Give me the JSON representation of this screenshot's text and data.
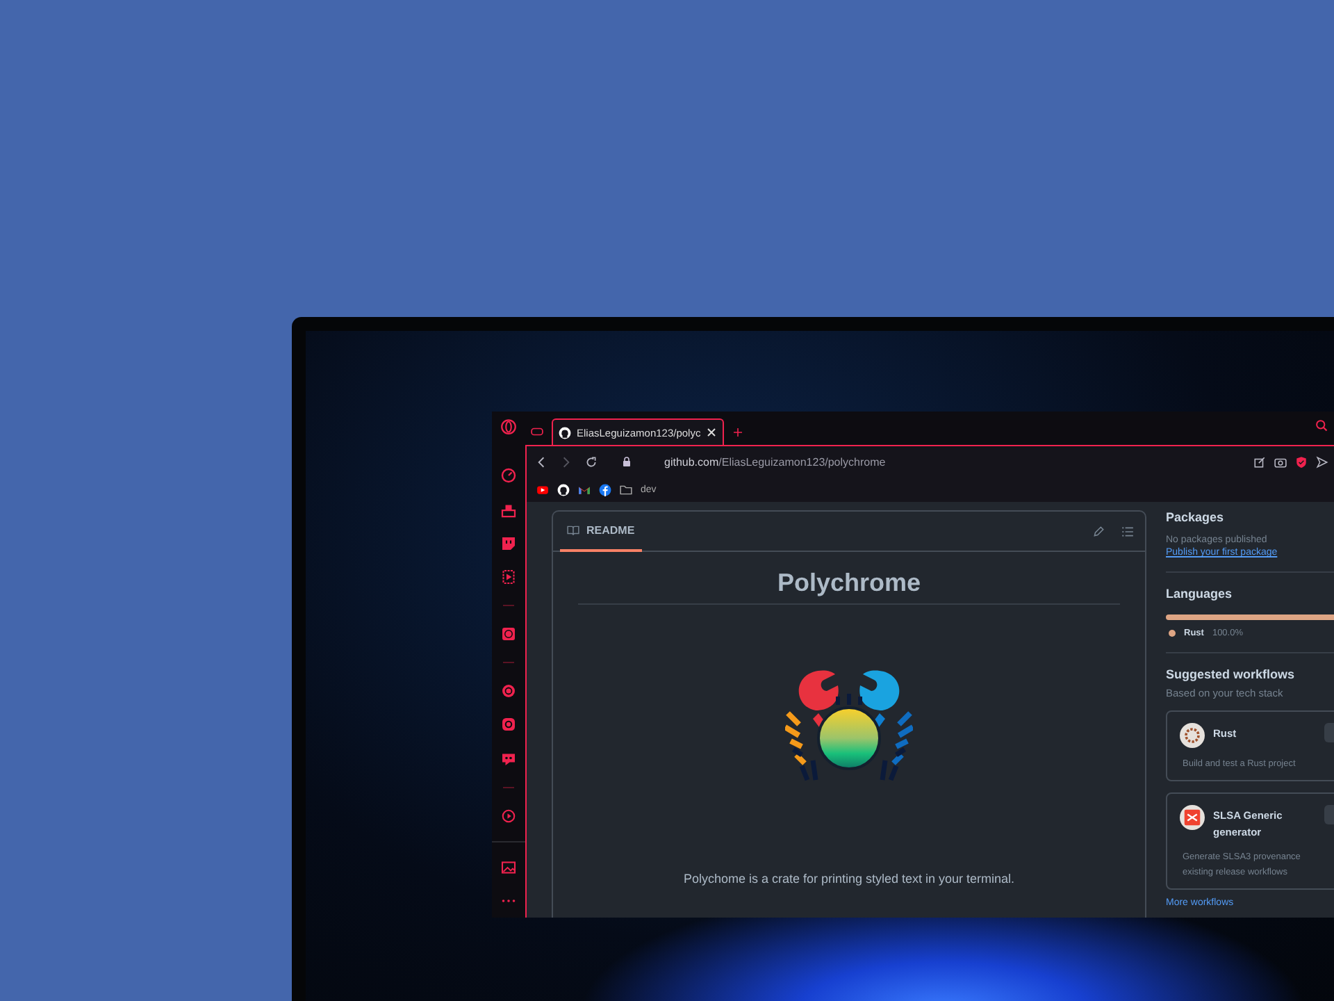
{
  "tabs": [
    {
      "title": "EliasLeguizamon123/polyc",
      "selected": true
    }
  ],
  "address_bar": {
    "domain": "github.com",
    "path": "/EliasLeguizamon123/polychrome"
  },
  "bookmarks": [
    {
      "kind": "youtube"
    },
    {
      "kind": "github"
    },
    {
      "kind": "gmail"
    },
    {
      "kind": "facebook"
    },
    {
      "kind": "folder",
      "label": "dev"
    }
  ],
  "readme": {
    "tab": "README",
    "title": "Polychrome",
    "description": "Polychome is a crate for printing styled text in your terminal."
  },
  "packages": {
    "heading": "Packages",
    "empty_text": "No packages published",
    "link": "Publish your first package"
  },
  "languages": {
    "heading": "Languages",
    "items": [
      {
        "name": "Rust",
        "percent": "100.0%",
        "color": "#dea584",
        "level": 1
      }
    ]
  },
  "workflows": {
    "heading": "Suggested workflows",
    "subtitle": "Based on your tech stack",
    "items": [
      {
        "kind": "rust",
        "name": "Rust",
        "description": [
          "Build and test a Rust project"
        ]
      },
      {
        "kind": "slsa",
        "name": "SLSA Generic generator",
        "description": [
          "Generate SLSA3 provenance",
          "existing release workflows"
        ]
      }
    ],
    "more_link": "More workflows"
  }
}
